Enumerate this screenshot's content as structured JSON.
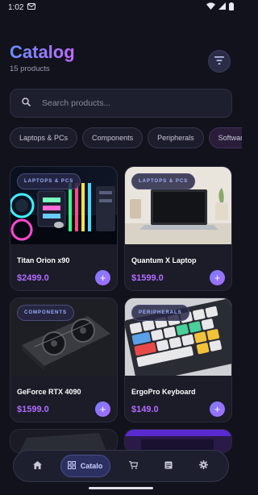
{
  "status": {
    "time": "1:02"
  },
  "header": {
    "title": "Catalog",
    "subtitle": "15 products"
  },
  "search": {
    "placeholder": "Search products..."
  },
  "categories": [
    "Laptops & PCs",
    "Components",
    "Peripherals",
    "Software"
  ],
  "products": [
    {
      "badge": "LAPTOPS & PCS",
      "name": "Titan Orion x90",
      "price": "$2499.0"
    },
    {
      "badge": "LAPTOPS & PCS",
      "name": "Quantum X Laptop",
      "price": "$1599.0"
    },
    {
      "badge": "COMPONENTS",
      "name": "GeForce RTX 4090",
      "price": "$1599.0"
    },
    {
      "badge": "PERIPHERALS",
      "name": "ErgoPro Keyboard",
      "price": "$149.0"
    }
  ],
  "nav": {
    "active_label": "Catalo"
  },
  "colors": {
    "accent": "#b36cff",
    "background": "#12121c",
    "active_nav": "#2c3060"
  }
}
